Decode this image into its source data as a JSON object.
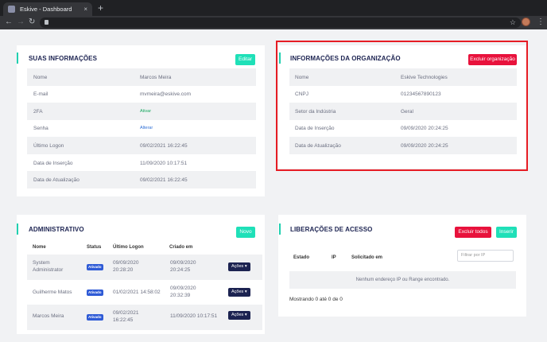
{
  "browser": {
    "tab_title": "Eskive - Dashboard",
    "new_tab": "+",
    "close": "×"
  },
  "user_info": {
    "title": "SUAS INFORMAÇÕES",
    "edit_label": "Editar",
    "rows": [
      {
        "label": "Nome",
        "value": "Marcos Meira"
      },
      {
        "label": "E-mail",
        "value": "mvmeira@eskive.com"
      },
      {
        "label": "2FA",
        "value": "Ativar"
      },
      {
        "label": "Senha",
        "value": "Alterar"
      },
      {
        "label": "Último Logon",
        "value": "09/02/2021 16:22:45"
      },
      {
        "label": "Data de Inserção",
        "value": "11/09/2020 10:17:51"
      },
      {
        "label": "Data de Atualização",
        "value": "09/02/2021 16:22:45"
      }
    ]
  },
  "organization": {
    "title": "INFORMAÇÕES DA ORGANIZAÇÃO",
    "delete_label": "Excluir organização",
    "rows": [
      {
        "label": "Nome",
        "value": "Eskive Technologies"
      },
      {
        "label": "CNPJ",
        "value": "01234567890123"
      },
      {
        "label": "Setor da Indústria",
        "value": "Geral"
      },
      {
        "label": "Data de Inserção",
        "value": "09/09/2020 20:24:25"
      },
      {
        "label": "Data de Atualização",
        "value": "09/09/2020 20:24:25"
      }
    ]
  },
  "admin": {
    "title": "ADMINISTRATIVO",
    "new_label": "Novo",
    "columns": [
      "Nome",
      "Status",
      "Último Logon",
      "Criado em"
    ],
    "rows": [
      {
        "name1": "System",
        "name2": "Administrator",
        "status": "Ativado",
        "logon1": "09/09/2020",
        "logon2": "20:28:20",
        "created1": "09/09/2020",
        "created2": "20:24:25",
        "action": "Ações ▾"
      },
      {
        "name1": "Guilherme Matos",
        "name2": "",
        "status": "Ativado",
        "logon1": "01/02/2021 14:58:02",
        "logon2": "",
        "created1": "09/09/2020",
        "created2": "20:32:39",
        "action": "Ações ▾"
      },
      {
        "name1": "Marcos Meira",
        "name2": "",
        "status": "Ativado",
        "logon1": "09/02/2021",
        "logon2": "16:22:45",
        "created1": "11/09/2020 10:17:51",
        "created2": "",
        "action": "Ações ▾"
      }
    ]
  },
  "access": {
    "title": "LIBERAÇÕES DE ACESSO",
    "delete_all_label": "Excluir todos",
    "insert_label": "Inserir",
    "filter_placeholder": "Filtrar por IP",
    "columns": [
      "Estado",
      "IP",
      "Solicitado em"
    ],
    "empty_message": "Nenhum endereço IP ou Range encontrado.",
    "footer": "Mostrando 0 até 0 de 0"
  }
}
